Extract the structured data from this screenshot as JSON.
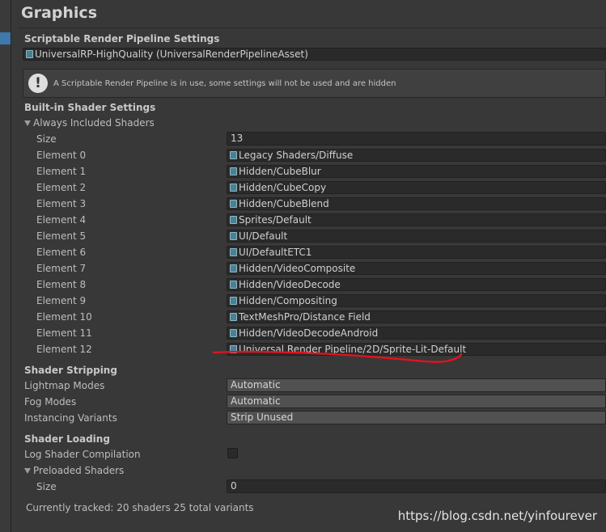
{
  "panel": {
    "title": "Graphics"
  },
  "srp": {
    "heading": "Scriptable Render Pipeline Settings",
    "asset_value": "UniversalRP-HighQuality (UniversalRenderPipelineAsset)",
    "help_text": "A Scriptable Render Pipeline is in use, some settings will not be used and are hidden",
    "help_icon_glyph": "!"
  },
  "builtin": {
    "heading": "Built-in Shader Settings",
    "foldout_label": "Always Included Shaders",
    "size_label": "Size",
    "size_value": "13",
    "elements": [
      {
        "label": "Element 0",
        "value": "Legacy Shaders/Diffuse"
      },
      {
        "label": "Element 1",
        "value": "Hidden/CubeBlur"
      },
      {
        "label": "Element 2",
        "value": "Hidden/CubeCopy"
      },
      {
        "label": "Element 3",
        "value": "Hidden/CubeBlend"
      },
      {
        "label": "Element 4",
        "value": "Sprites/Default"
      },
      {
        "label": "Element 5",
        "value": "UI/Default"
      },
      {
        "label": "Element 6",
        "value": "UI/DefaultETC1"
      },
      {
        "label": "Element 7",
        "value": "Hidden/VideoComposite"
      },
      {
        "label": "Element 8",
        "value": "Hidden/VideoDecode"
      },
      {
        "label": "Element 9",
        "value": "Hidden/Compositing"
      },
      {
        "label": "Element 10",
        "value": "TextMeshPro/Distance Field"
      },
      {
        "label": "Element 11",
        "value": "Hidden/VideoDecodeAndroid"
      },
      {
        "label": "Element 12",
        "value": "Universal Render Pipeline/2D/Sprite-Lit-Default"
      }
    ]
  },
  "stripping": {
    "heading": "Shader Stripping",
    "rows": [
      {
        "label": "Lightmap Modes",
        "value": "Automatic"
      },
      {
        "label": "Fog Modes",
        "value": "Automatic"
      },
      {
        "label": "Instancing Variants",
        "value": "Strip Unused"
      }
    ]
  },
  "loading": {
    "heading": "Shader Loading",
    "log_label": "Log Shader Compilation",
    "log_checked": false,
    "preloaded_label": "Preloaded Shaders",
    "size_label": "Size",
    "size_value": "0"
  },
  "footer": {
    "tracked_text": "Currently tracked: 20 shaders 25 total variants"
  },
  "watermark": "https://blog.csdn.net/yinfourever",
  "colors": {
    "background": "#383838",
    "annotation_underline": "#e0141e",
    "selection_strip": "#3e78ad"
  }
}
